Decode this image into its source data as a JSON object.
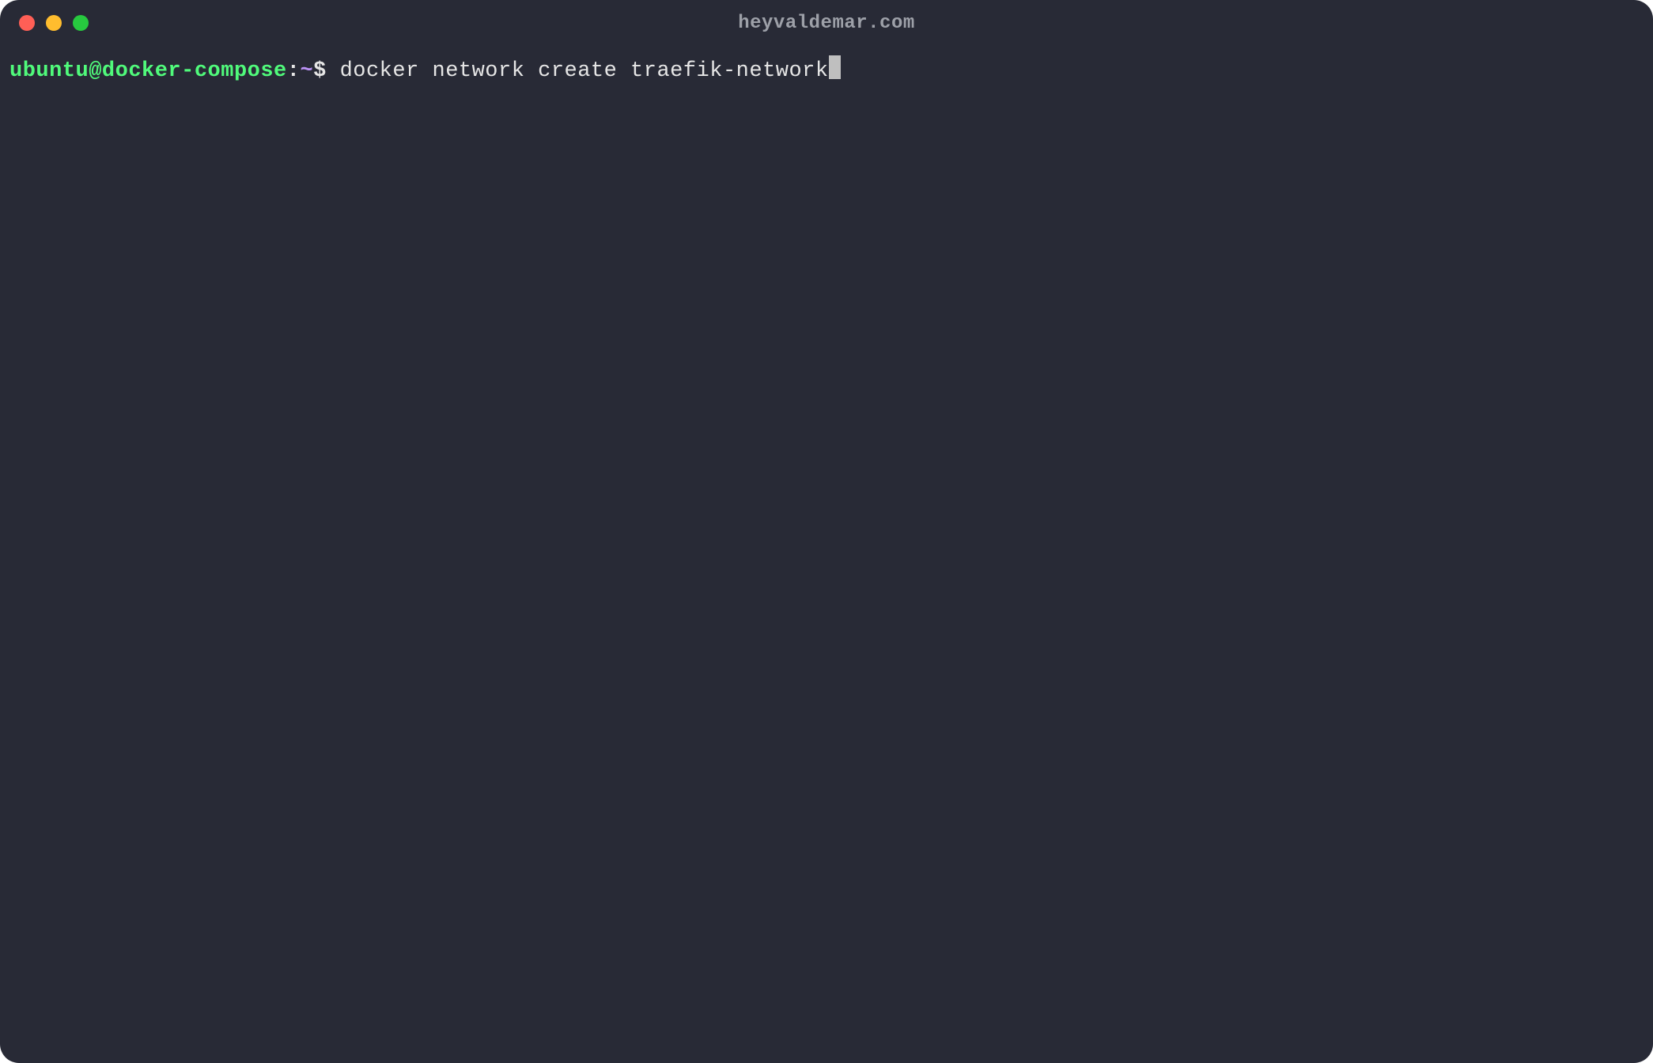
{
  "window": {
    "title": "heyvaldemar.com"
  },
  "prompt": {
    "user_host": "ubuntu@docker-compose",
    "separator": ":",
    "path": "~",
    "symbol": "$"
  },
  "command": "docker network create traefik-network",
  "colors": {
    "background": "#282a36",
    "user_host": "#50fa7b",
    "path": "#bd93f9",
    "text": "#e6e6e6",
    "title": "#9da0a8",
    "red": "#ff5f56",
    "yellow": "#ffbd2e",
    "green": "#27c93f"
  }
}
